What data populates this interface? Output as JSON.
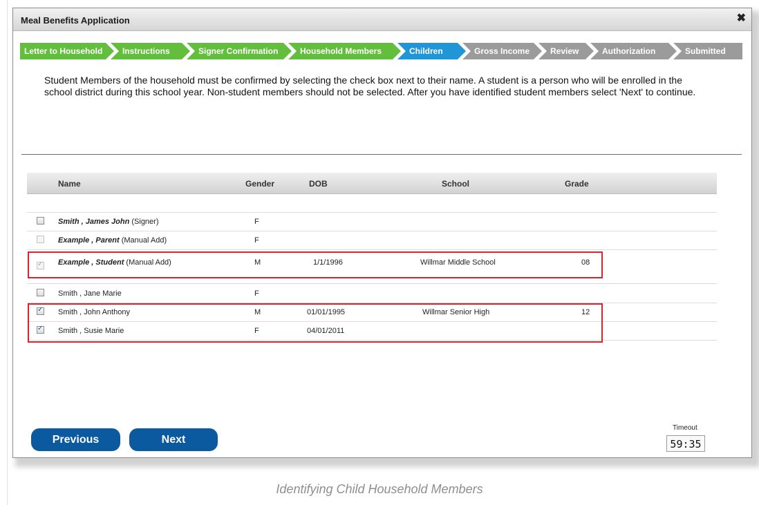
{
  "dialog": {
    "title": "Meal Benefits Application",
    "close_icon": "✖"
  },
  "steps": [
    {
      "label": "Letter to Household",
      "state": "done"
    },
    {
      "label": "Instructions",
      "state": "done"
    },
    {
      "label": "Signer Confirmation",
      "state": "done"
    },
    {
      "label": "Household Members",
      "state": "done"
    },
    {
      "label": "Children",
      "state": "active"
    },
    {
      "label": "Gross Income",
      "state": "todo"
    },
    {
      "label": "Review",
      "state": "todo"
    },
    {
      "label": "Authorization",
      "state": "todo"
    },
    {
      "label": "Submitted",
      "state": "todo"
    }
  ],
  "instructions": "Student Members of the household must be confirmed by selecting the check box next to their name. A student is a person who will be enrolled in the school district during this school year. Non-student members should not be selected. After you have identified student members select 'Next' to continue.",
  "table": {
    "headers": {
      "name": "Name",
      "gender": "Gender",
      "dob": "DOB",
      "school": "School",
      "grade": "Grade"
    },
    "rows": [
      {
        "name_bold": "Smith , James John",
        "name_suffix": " (Signer)",
        "gender": "F",
        "dob": "",
        "school": "",
        "grade": "",
        "checked": false,
        "disabled": false
      },
      {
        "name_bold": "Example , Parent",
        "name_suffix": " (Manual Add)",
        "gender": "F",
        "dob": "",
        "school": "",
        "grade": "",
        "checked": false,
        "disabled": true
      },
      {
        "name_bold": "Example , Student",
        "name_suffix": " (Manual Add)",
        "gender": "M",
        "dob": "1/1/1996",
        "school": "Willmar Middle School",
        "grade": "08",
        "checked": true,
        "disabled": true
      },
      {
        "name_bold": "",
        "name_suffix": "Smith , Jane Marie",
        "gender": "F",
        "dob": "",
        "school": "",
        "grade": "",
        "checked": false,
        "disabled": false
      },
      {
        "name_bold": "",
        "name_suffix": "Smith , John Anthony",
        "gender": "M",
        "dob": "01/01/1995",
        "school": "Willmar Senior High",
        "grade": "12",
        "checked": true,
        "disabled": false
      },
      {
        "name_bold": "",
        "name_suffix": "Smith , Susie Marie",
        "gender": "F",
        "dob": "04/01/2011",
        "school": "",
        "grade": "",
        "checked": true,
        "disabled": false
      }
    ]
  },
  "buttons": {
    "previous": "Previous",
    "next": "Next"
  },
  "timeout": {
    "label": "Timeout",
    "value": "59:35"
  },
  "caption": "Identifying Child Household Members",
  "colors": {
    "step_done": "#63be3d",
    "step_active": "#2196d6",
    "step_todo": "#9b9b9b",
    "button": "#0b5aa0",
    "highlight": "#d9232d"
  }
}
